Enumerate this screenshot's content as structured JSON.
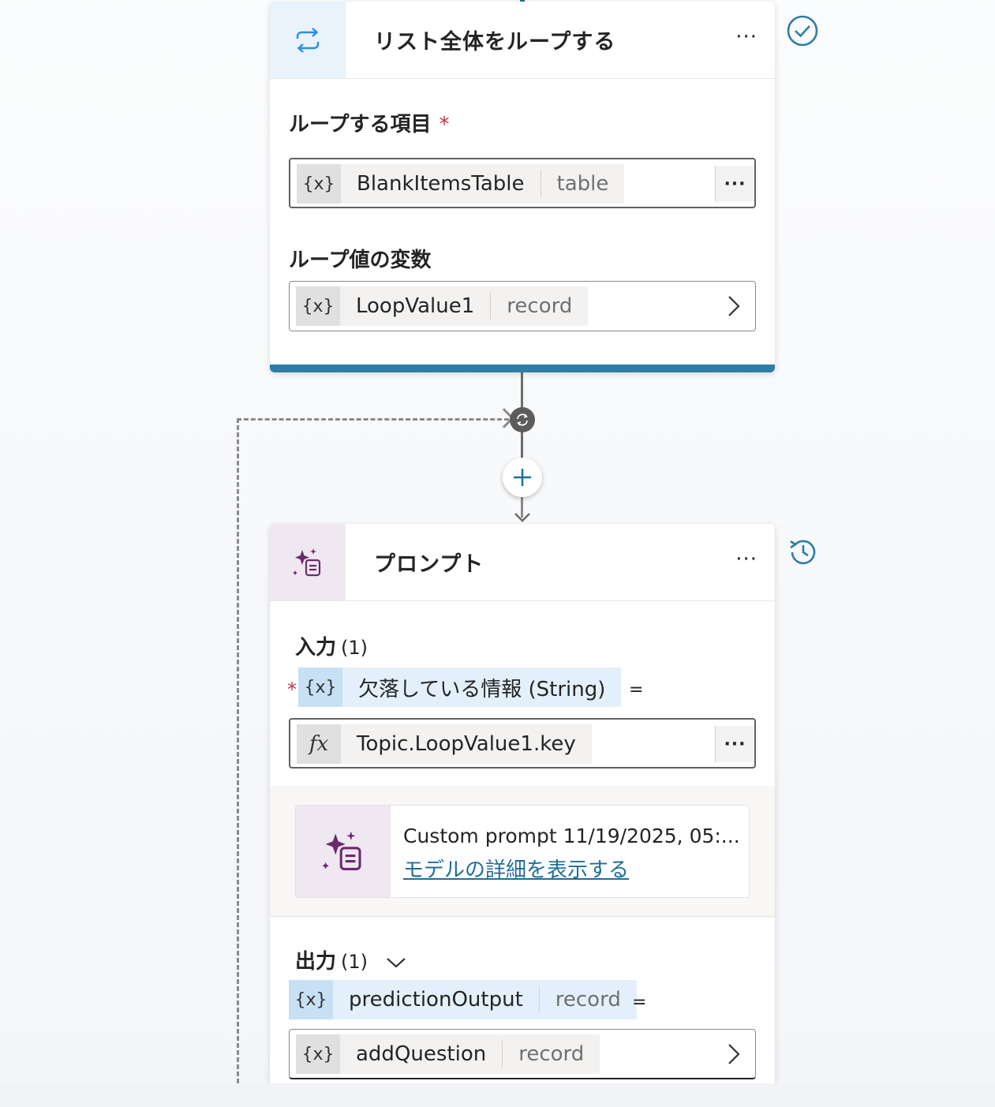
{
  "loop_node": {
    "title": "リスト全体をループする",
    "more_label": "···",
    "items_label": "ループする項目",
    "required_mark": "*",
    "items_var": {
      "icon": "{x}",
      "name": "BlankItemsTable",
      "type": "table"
    },
    "items_more": "···",
    "loop_value_label": "ループ値の変数",
    "loop_value_var": {
      "icon": "{x}",
      "name": "LoopValue1",
      "type": "record"
    },
    "status": "success-check-icon"
  },
  "prompt_node": {
    "title": "プロンプト",
    "more_label": "···",
    "input_label": "入力",
    "input_count": "(1)",
    "required_mark": "*",
    "input_var": {
      "icon": "{x}",
      "name": "欠落している情報 (String)"
    },
    "equals": "=",
    "input_formula": {
      "icon": "fx",
      "value": "Topic.LoopValue1.key"
    },
    "input_more": "···",
    "model": {
      "title": "Custom prompt 11/19/2025, 05:...",
      "link": "モデルの詳細を表示する"
    },
    "output_label": "出力",
    "output_count": "(1)",
    "output_var": {
      "icon": "{x}",
      "name": "predictionOutput",
      "type": "record"
    },
    "output_target": {
      "icon": "{x}",
      "name": "addQuestion",
      "type": "record"
    },
    "status": "history-icon"
  },
  "colors": {
    "accent": "#2f7ca8",
    "required": "#c4314b",
    "link": "#1e6e9a",
    "chip": "#e3f0fb"
  }
}
